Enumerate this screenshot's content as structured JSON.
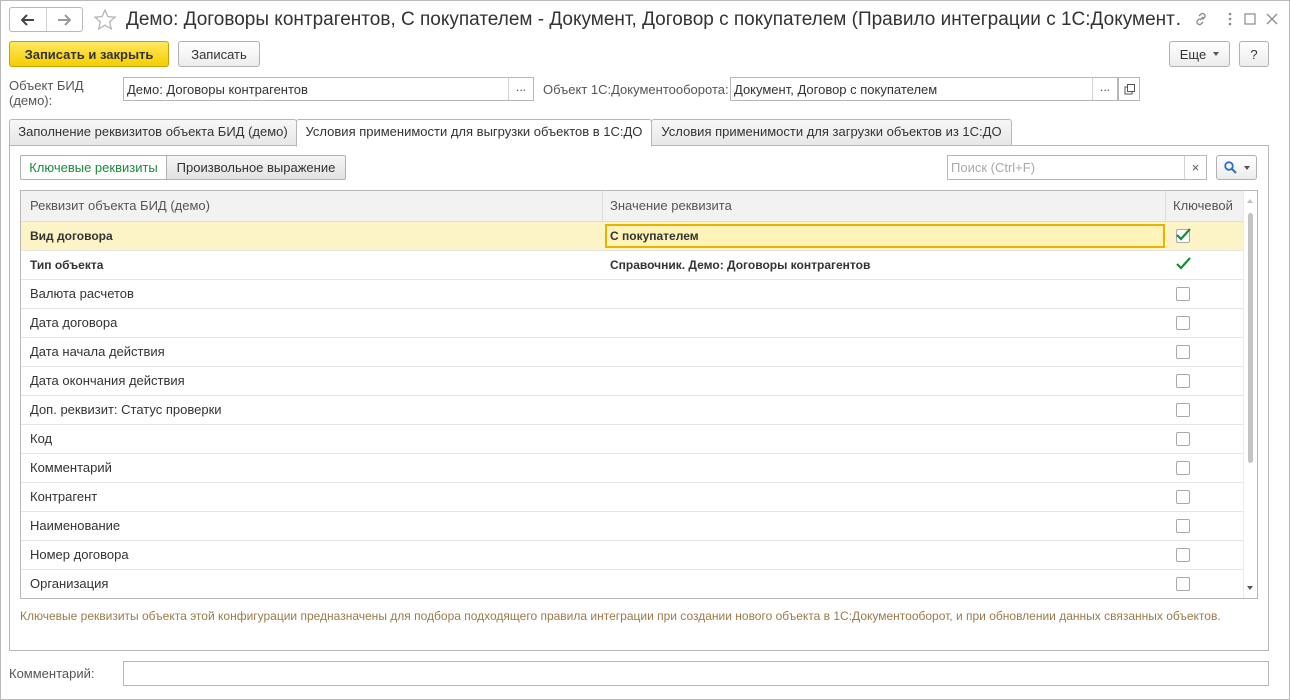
{
  "window": {
    "title": "Демо: Договоры контрагентов, С покупателем - Документ, Договор с покупателем (Правило интеграции с 1С:Документ…"
  },
  "toolbar": {
    "save_close_label": "Записать и закрыть",
    "save_label": "Записать",
    "more_label": "Еще",
    "help_label": "?"
  },
  "form": {
    "bid_object_label": "Объект БИД (демо):",
    "bid_object_value": "Демо: Договоры контрагентов",
    "do_object_label": "Объект 1С:Документооборота:",
    "do_object_value": "Документ, Договор с покупателем",
    "select_glyph": "..."
  },
  "tabs": [
    {
      "label": "Заполнение реквизитов объекта БИД (демо)",
      "active": false
    },
    {
      "label": "Условия применимости для выгрузки объектов в 1С:ДО",
      "active": true
    },
    {
      "label": "Условия применимости для загрузки объектов из 1С:ДО",
      "active": false
    }
  ],
  "mode_toggle": {
    "key_label": "Ключевые реквизиты",
    "expr_label": "Произвольное выражение"
  },
  "search": {
    "placeholder": "Поиск (Ctrl+F)",
    "clear_glyph": "×"
  },
  "table": {
    "columns": [
      "Реквизит объекта БИД (демо)",
      "Значение реквизита",
      "Ключевой"
    ],
    "rows": [
      {
        "attr": "Вид договора",
        "value": "С покупателем",
        "key": true,
        "bold": true,
        "selected": true
      },
      {
        "attr": "Тип объекта",
        "value": "Справочник. Демо: Договоры контрагентов",
        "key": true,
        "bold": true,
        "selected": false
      },
      {
        "attr": "Валюта расчетов",
        "value": "",
        "key": false,
        "bold": false,
        "selected": false
      },
      {
        "attr": "Дата договора",
        "value": "",
        "key": false,
        "bold": false,
        "selected": false
      },
      {
        "attr": "Дата начала действия",
        "value": "",
        "key": false,
        "bold": false,
        "selected": false
      },
      {
        "attr": "Дата окончания действия",
        "value": "",
        "key": false,
        "bold": false,
        "selected": false
      },
      {
        "attr": "Доп. реквизит: Статус проверки",
        "value": "",
        "key": false,
        "bold": false,
        "selected": false
      },
      {
        "attr": "Код",
        "value": "",
        "key": false,
        "bold": false,
        "selected": false
      },
      {
        "attr": "Комментарий",
        "value": "",
        "key": false,
        "bold": false,
        "selected": false
      },
      {
        "attr": "Контрагент",
        "value": "",
        "key": false,
        "bold": false,
        "selected": false
      },
      {
        "attr": "Наименование",
        "value": "",
        "key": false,
        "bold": false,
        "selected": false
      },
      {
        "attr": "Номер договора",
        "value": "",
        "key": false,
        "bold": false,
        "selected": false
      },
      {
        "attr": "Организация",
        "value": "",
        "key": false,
        "bold": false,
        "selected": false
      }
    ]
  },
  "hint": "Ключевые реквизиты объекта этой конфигурации предназначены для подбора подходящего правила интеграции при создании нового объекта в 1С:Документооборот, и при обновлении данных связанных объектов.",
  "comment": {
    "label": "Комментарий:",
    "value": ""
  },
  "colors": {
    "accent_green": "#1b8a3a",
    "primary_button": "#f5cf00",
    "selected_row": "#fcf3c6",
    "hint_text": "#9a7a4a"
  },
  "icons": [
    "back-arrow-icon",
    "forward-arrow-icon",
    "favorite-star-icon",
    "link-icon",
    "more-vert-icon",
    "maximize-icon",
    "close-icon",
    "open-external-icon",
    "search-icon",
    "checkmark-icon"
  ]
}
